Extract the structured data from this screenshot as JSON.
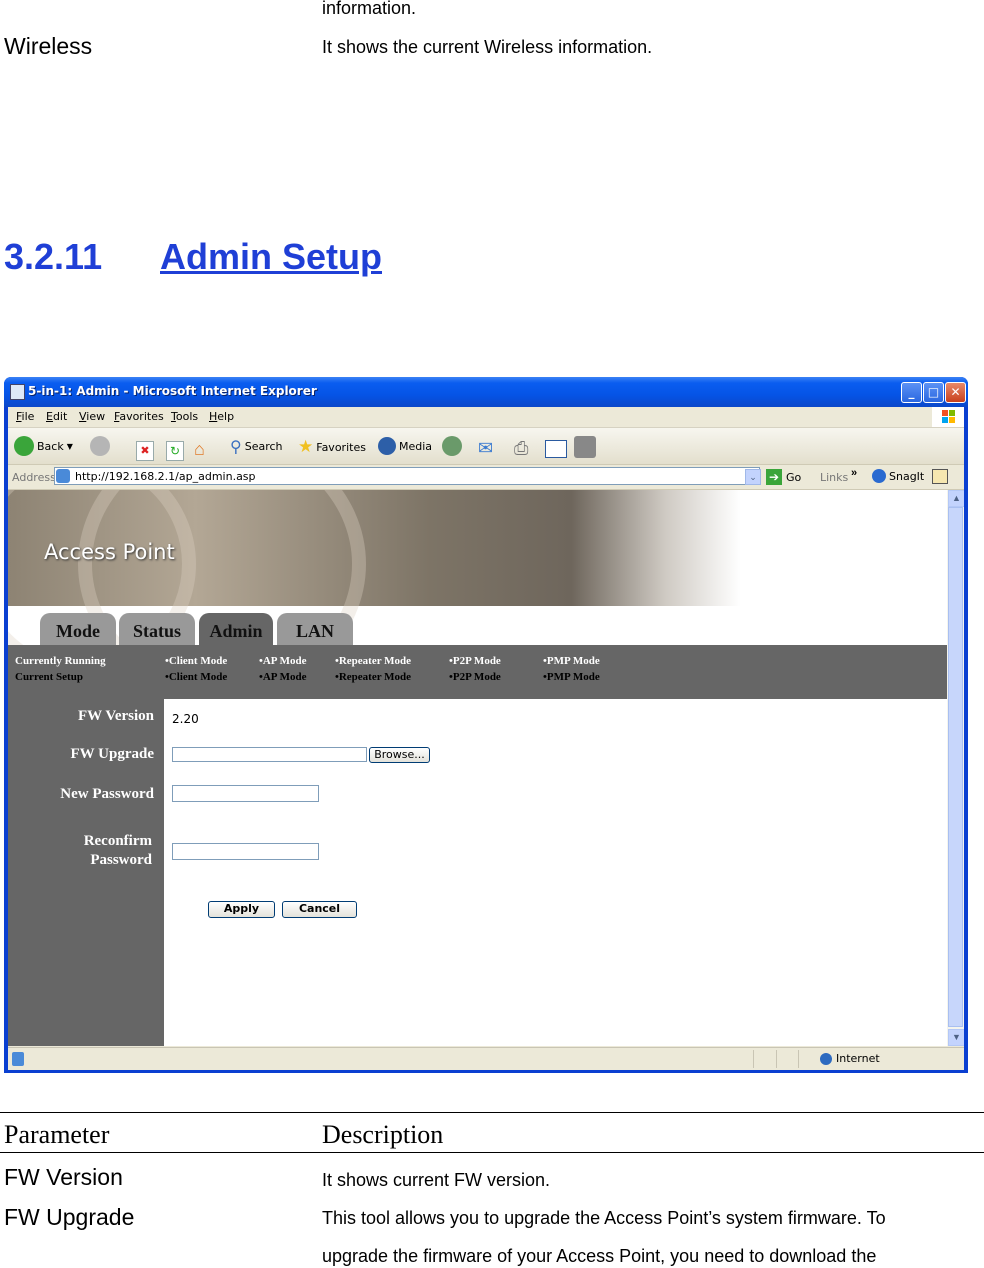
{
  "document": {
    "prev_desc_tail": "information.",
    "wireless_param": "Wireless",
    "wireless_desc": "It shows the current Wireless information.",
    "section_number": "3.2.11",
    "section_title": "Admin Setup"
  },
  "browser": {
    "window_title": "5-in-1: Admin - Microsoft Internet Explorer",
    "window_buttons": {
      "minimize": "_",
      "maximize": "□",
      "close": "✕"
    },
    "menu": [
      "File",
      "Edit",
      "View",
      "Favorites",
      "Tools",
      "Help"
    ],
    "toolbar": {
      "back": "Back",
      "search": "Search",
      "favorites": "Favorites",
      "media": "Media"
    },
    "address_label": "Address",
    "address_url": "http://192.168.2.1/ap_admin.asp",
    "go_label": "Go",
    "links_label": "Links",
    "links_chevron": "»",
    "snagit_label": "SnagIt",
    "status_zone": "Internet"
  },
  "page": {
    "banner_title": "Access Point",
    "tabs": [
      {
        "label": "Mode",
        "active": false
      },
      {
        "label": "Status",
        "active": false
      },
      {
        "label": "Admin",
        "active": true
      },
      {
        "label": "LAN",
        "active": false
      }
    ],
    "modes": {
      "running_label": "Currently Running",
      "setup_label": "Current Setup",
      "items": [
        "•Client Mode",
        "•AP Mode",
        "•Repeater Mode",
        "•P2P Mode",
        "•PMP Mode"
      ]
    },
    "form": {
      "fw_version_label": "FW Version",
      "fw_version_value": "2.20",
      "fw_upgrade_label": "FW Upgrade",
      "fw_upgrade_value": "",
      "browse_label": "Browse...",
      "new_password_label": "New Password",
      "new_password_value": "",
      "reconfirm_label_1": "Reconfirm",
      "reconfirm_label_2": "Password",
      "reconfirm_value": "",
      "apply_label": "Apply",
      "cancel_label": "Cancel"
    }
  },
  "param_table": {
    "header_param": "Parameter",
    "header_desc": "Description",
    "rows": [
      {
        "param": "FW Version",
        "desc": [
          "It shows current FW version."
        ]
      },
      {
        "param": "FW Upgrade",
        "desc": [
          "This tool allows you to upgrade the Access Point’s system firmware. To",
          "upgrade the firmware of your Access Point, you need to download the"
        ]
      }
    ]
  }
}
